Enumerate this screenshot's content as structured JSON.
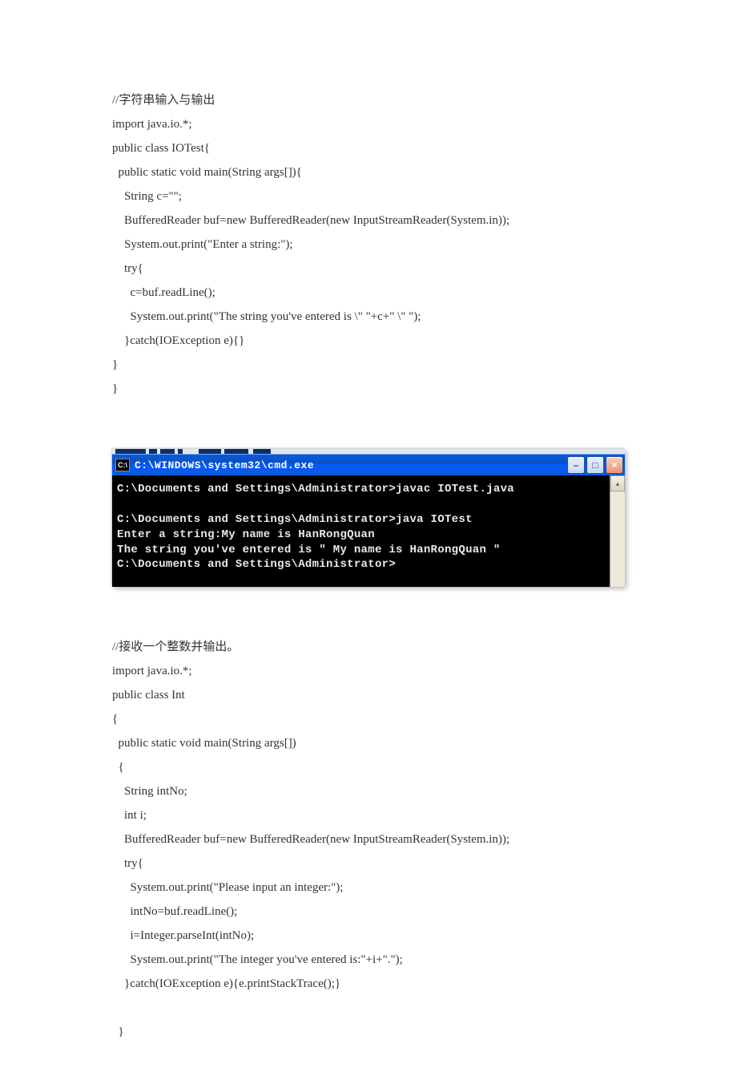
{
  "code1": {
    "l1": "//字符串输入与输出",
    "l2": "import java.io.*;",
    "l3": "public class IOTest{",
    "l4": "  public static void main(String args[]){",
    "l5": "    String c=\"\";",
    "l6": "    BufferedReader buf=new BufferedReader(new InputStreamReader(System.in));",
    "l7": "    System.out.print(\"Enter a string:\");",
    "l8": "    try{",
    "l9": "      c=buf.readLine();",
    "l10": "      System.out.print(\"The string you've entered is \\\" \"+c+\" \\\" \");",
    "l11": "    }catch(IOException e){}",
    "l12": "}",
    "l13": "}"
  },
  "cmdwin": {
    "title": "C:\\WINDOWS\\system32\\cmd.exe",
    "badge": "C:\\",
    "minimize": "–",
    "maximize": "□",
    "close": "×",
    "scroll_up": "▴",
    "t1": "C:\\Documents and Settings\\Administrator>javac IOTest.java",
    "t2": "",
    "t3": "C:\\Documents and Settings\\Administrator>java IOTest",
    "t4": "Enter a string:My name is HanRongQuan",
    "t5": "The string you've entered is \" My name is HanRongQuan \"",
    "t6": "C:\\Documents and Settings\\Administrator>"
  },
  "code2": {
    "l1": "//接收一个整数并输出。",
    "l2": "import java.io.*;",
    "l3": "public class Int",
    "l4": "{",
    "l5": "  public static void main(String args[])",
    "l6": "  {",
    "l7": "    String intNo;",
    "l8": "    int i;",
    "l9": "    BufferedReader buf=new BufferedReader(new InputStreamReader(System.in));",
    "l10": "    try{",
    "l11": "      System.out.print(\"Please input an integer:\");",
    "l12": "      intNo=buf.readLine();",
    "l13": "      i=Integer.parseInt(intNo);",
    "l14": "      System.out.print(\"The integer you've entered is:\"+i+\".\");",
    "l15": "    }catch(IOException e){e.printStackTrace();}",
    "l16": "",
    "l17": "  }"
  }
}
